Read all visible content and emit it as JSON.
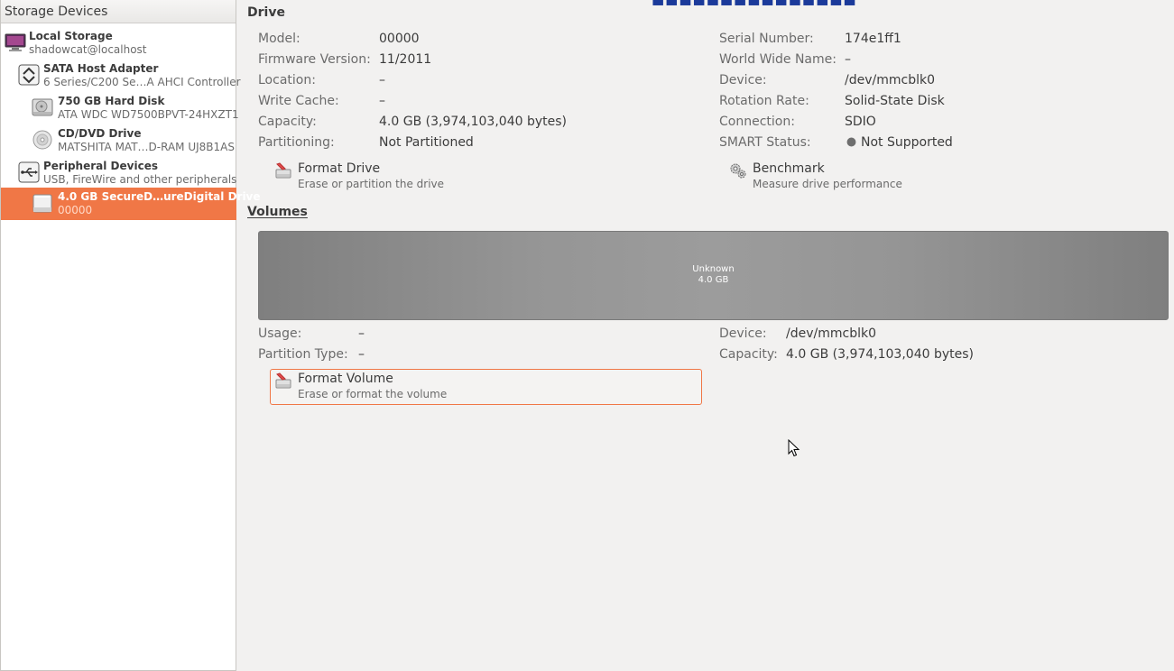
{
  "sidebar": {
    "header": "Storage Devices",
    "items": [
      {
        "title": "Local Storage",
        "subtitle": "shadowcat@localhost",
        "icon": "computer-icon"
      },
      {
        "title": "SATA Host Adapter",
        "subtitle": "6 Series/C200 Se…A AHCI Controller",
        "icon": "host-adapter-icon"
      },
      {
        "title": "750 GB Hard Disk",
        "subtitle": "ATA WDC WD7500BPVT-24HXZT1",
        "icon": "hard-disk-icon"
      },
      {
        "title": "CD/DVD Drive",
        "subtitle": "MATSHITA MAT…D-RAM UJ8B1AS",
        "icon": "optical-disc-icon"
      },
      {
        "title": "Peripheral Devices",
        "subtitle": "USB, FireWire and other peripherals",
        "icon": "usb-icon"
      },
      {
        "title": "4.0 GB SecureD…ureDigital Drive",
        "subtitle": "00000",
        "icon": "sd-card-icon",
        "selected": true
      }
    ]
  },
  "drive": {
    "title": "Drive",
    "left": [
      {
        "label": "Model:",
        "value": "00000"
      },
      {
        "label": "Firmware Version:",
        "value": "11/2011"
      },
      {
        "label": "Location:",
        "value": "–"
      },
      {
        "label": "Write Cache:",
        "value": "–"
      },
      {
        "label": "Capacity:",
        "value": "4.0 GB (3,974,103,040 bytes)"
      },
      {
        "label": "Partitioning:",
        "value": "Not Partitioned"
      }
    ],
    "right": [
      {
        "label": "Serial Number:",
        "value": "174e1ff1"
      },
      {
        "label": "World Wide Name:",
        "value": "–"
      },
      {
        "label": "Device:",
        "value": "/dev/mmcblk0"
      },
      {
        "label": "Rotation Rate:",
        "value": "Solid-State Disk"
      },
      {
        "label": "Connection:",
        "value": "SDIO"
      },
      {
        "label": "SMART Status:",
        "value": "Not Supported"
      }
    ],
    "format_action": {
      "title": "Format Drive",
      "subtitle": "Erase or partition the drive"
    },
    "benchmark_action": {
      "title": "Benchmark",
      "subtitle": "Measure drive performance"
    }
  },
  "volumes": {
    "title": "Volumes",
    "bar": {
      "name": "Unknown",
      "size": "4.0 GB"
    },
    "left": [
      {
        "label": "Usage:",
        "value": "–"
      },
      {
        "label": "Partition Type:",
        "value": "–"
      }
    ],
    "right": [
      {
        "label": "Device:",
        "value": "/dev/mmcblk0"
      },
      {
        "label": "Capacity:",
        "value": "4.0 GB (3,974,103,040 bytes)"
      }
    ],
    "format_action": {
      "title": "Format Volume",
      "subtitle": "Erase or format the volume"
    }
  },
  "colors": {
    "accent": "#f07746",
    "volume_bar": "#8f8f8f"
  }
}
